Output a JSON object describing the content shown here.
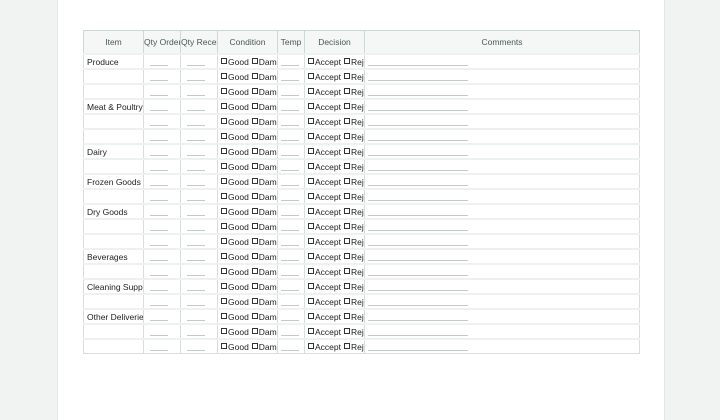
{
  "columns": [
    "Item",
    "Qty Ordered",
    "Qty Received",
    "Condition",
    "Temp",
    "Decision",
    "Comments"
  ],
  "condition_options": [
    "Good",
    "Damaged"
  ],
  "decision_options": [
    "Accept",
    "Reject"
  ],
  "groups": [
    {
      "name": "Produce",
      "rows": 3
    },
    {
      "name": "Meat & Poultry",
      "rows": 3
    },
    {
      "name": "Dairy",
      "rows": 2
    },
    {
      "name": "Frozen Goods",
      "rows": 2
    },
    {
      "name": "Dry Goods",
      "rows": 3
    },
    {
      "name": "Beverages",
      "rows": 2
    },
    {
      "name": "Cleaning Supplies",
      "rows": 2
    },
    {
      "name": "Other Deliveries",
      "rows": 3
    }
  ]
}
